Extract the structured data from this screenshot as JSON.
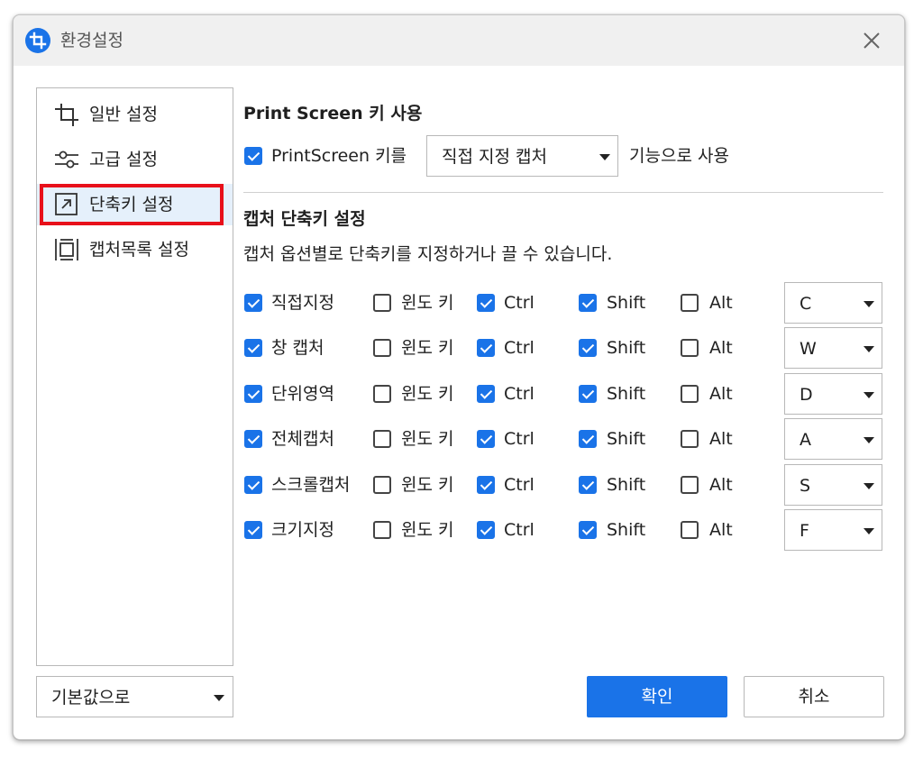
{
  "window": {
    "title": "환경설정"
  },
  "sidebar": {
    "items": [
      {
        "label": "일반 설정",
        "icon": "crop-icon"
      },
      {
        "label": "고급 설정",
        "icon": "sliders-icon"
      },
      {
        "label": "단축키 설정",
        "icon": "shortcut-arrow-icon",
        "active": true
      },
      {
        "label": "캡처목록 설정",
        "icon": "capture-list-icon"
      }
    ],
    "default_select": "기본값으로"
  },
  "printscreen": {
    "title": "Print Screen 키 사용",
    "checkbox_label": "PrintScreen 키를",
    "checked": true,
    "mode": "직접 지정 캡처",
    "suffix": "기능으로 사용"
  },
  "shortcuts": {
    "title": "캡처 단축키 설정",
    "description": "캡처 옵션별로 단축키를 지정하거나 끌 수 있습니다.",
    "modifier_labels": {
      "win": "윈도 키",
      "ctrl": "Ctrl",
      "shift": "Shift",
      "alt": "Alt"
    },
    "rows": [
      {
        "name": "직접지정",
        "enabled": true,
        "win": false,
        "ctrl": true,
        "shift": true,
        "alt": false,
        "key": "C"
      },
      {
        "name": "창 캡처",
        "enabled": true,
        "win": false,
        "ctrl": true,
        "shift": true,
        "alt": false,
        "key": "W"
      },
      {
        "name": "단위영역",
        "enabled": true,
        "win": false,
        "ctrl": true,
        "shift": true,
        "alt": false,
        "key": "D"
      },
      {
        "name": "전체캡처",
        "enabled": true,
        "win": false,
        "ctrl": true,
        "shift": true,
        "alt": false,
        "key": "A"
      },
      {
        "name": "스크롤캡처",
        "enabled": true,
        "win": false,
        "ctrl": true,
        "shift": true,
        "alt": false,
        "key": "S"
      },
      {
        "name": "크기지정",
        "enabled": true,
        "win": false,
        "ctrl": true,
        "shift": true,
        "alt": false,
        "key": "F"
      }
    ]
  },
  "buttons": {
    "ok": "확인",
    "cancel": "취소"
  },
  "colors": {
    "accent": "#1a73e8",
    "highlight": "#e8101a"
  }
}
